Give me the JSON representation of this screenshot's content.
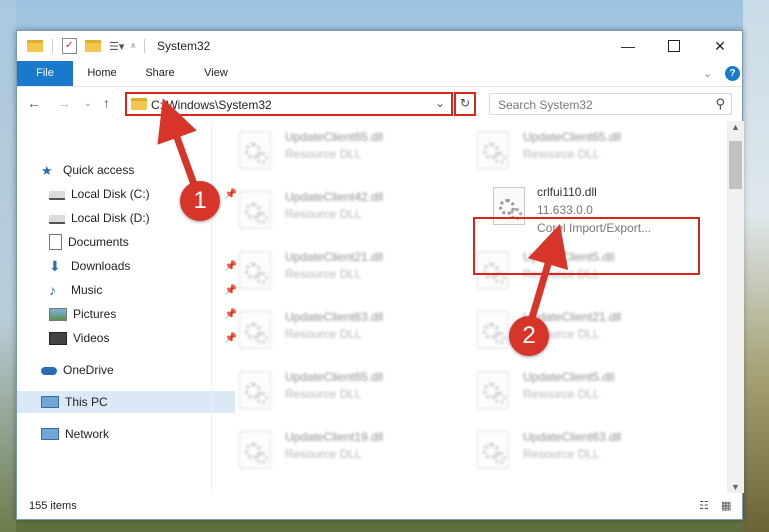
{
  "window": {
    "title": "System32"
  },
  "ribbon": {
    "tabs": [
      "File",
      "Home",
      "Share",
      "View"
    ]
  },
  "address": {
    "path": "C:\\Windows\\System32",
    "search_placeholder": "Search System32"
  },
  "sidebar": {
    "items": [
      {
        "label": "Quick access",
        "icon": "star-icon"
      },
      {
        "label": "Local Disk (C:)",
        "icon": "drive-icon"
      },
      {
        "label": "Local Disk (D:)",
        "icon": "drive-icon"
      },
      {
        "label": "Documents",
        "icon": "documents-icon"
      },
      {
        "label": "Downloads",
        "icon": "download-arrow-icon"
      },
      {
        "label": "Music",
        "icon": "music-note-icon"
      },
      {
        "label": "Pictures",
        "icon": "pictures-icon"
      },
      {
        "label": "Videos",
        "icon": "videos-icon"
      },
      {
        "label": "OneDrive",
        "icon": "cloud-icon"
      },
      {
        "label": "This PC",
        "icon": "computer-icon"
      },
      {
        "label": "Network",
        "icon": "network-icon"
      }
    ]
  },
  "files": [
    {
      "name": "UpdateClient65.dll",
      "desc": "Resource DLL"
    },
    {
      "name": "UpdateClient65.dll",
      "desc": "Resource DLL"
    },
    {
      "name": "UpdateClient42.dll",
      "desc": "Resource DLL"
    },
    {
      "name": "crlfui110.dll",
      "desc": "11.633.0.0",
      "desc2": "Corel Import/Export..."
    },
    {
      "name": "UpdateClient21.dll",
      "desc": "Resource DLL"
    },
    {
      "name": "UpdateClient5.dll",
      "desc": "Resource DLL"
    },
    {
      "name": "UpdateClient63.dll",
      "desc": "Resource DLL"
    },
    {
      "name": "UpdateClient21.dll",
      "desc": "Resource DLL"
    },
    {
      "name": "UpdateClient65.dll",
      "desc": "Resource DLL"
    },
    {
      "name": "UpdateClient5.dll",
      "desc": "Resource DLL"
    },
    {
      "name": "UpdateClient19.dll",
      "desc": "Resource DLL"
    },
    {
      "name": "UpdateClient63.dll",
      "desc": "Resource DLL"
    }
  ],
  "status": {
    "items": "155 items"
  },
  "annotations": {
    "step1": "1",
    "step2": "2"
  },
  "colors": {
    "accent": "#1979ca",
    "highlight": "#d9261c"
  }
}
